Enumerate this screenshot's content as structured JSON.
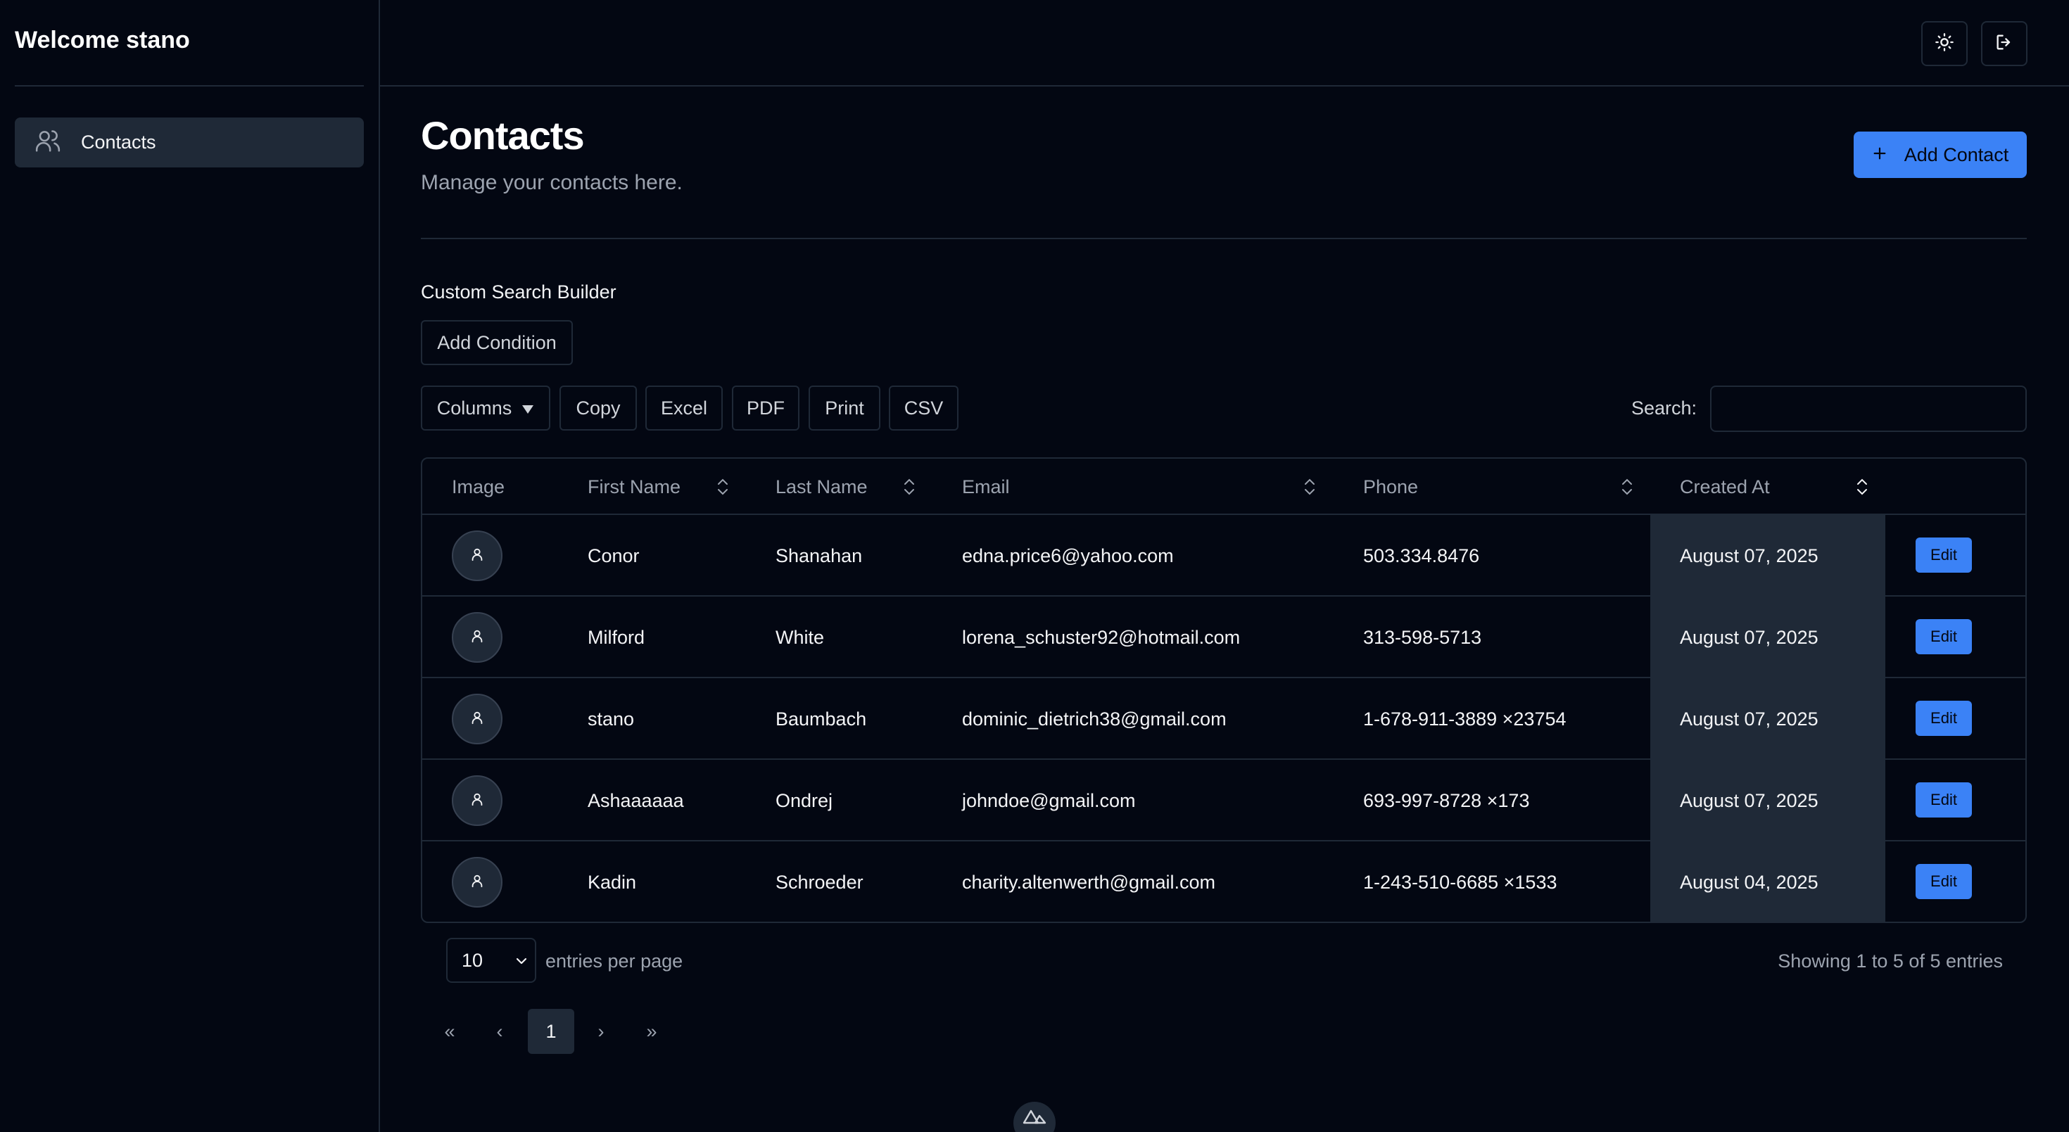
{
  "sidebar": {
    "title": "Welcome stano",
    "items": [
      {
        "label": "Contacts",
        "icon": "users-icon"
      }
    ]
  },
  "topbar": {
    "theme_icon": "sun-icon",
    "logout_icon": "logout-icon"
  },
  "main": {
    "title": "Contacts",
    "subtitle": "Manage your contacts here.",
    "add_button": {
      "label": "Add Contact",
      "icon": "plus-icon"
    },
    "search_builder": {
      "label": "Custom Search Builder",
      "add_condition": "Add Condition"
    },
    "toolbar": {
      "columns": "Columns",
      "copy": "Copy",
      "excel": "Excel",
      "pdf": "PDF",
      "print": "Print",
      "csv": "CSV",
      "search_label": "Search:",
      "search_value": ""
    },
    "table": {
      "headers": [
        "Image",
        "First Name",
        "Last Name",
        "Email",
        "Phone",
        "Created At"
      ],
      "rows": [
        {
          "first": "Conor",
          "last": "Shanahan",
          "email": "edna.price6@yahoo.com",
          "phone": "503.334.8476",
          "created": "August 07, 2025",
          "action": "Edit"
        },
        {
          "first": "Milford",
          "last": "White",
          "email": "lorena_schuster92@hotmail.com",
          "phone": "313-598-5713",
          "created": "August 07, 2025",
          "action": "Edit"
        },
        {
          "first": "stano",
          "last": "Baumbach",
          "email": "dominic_dietrich38@gmail.com",
          "phone": "1-678-911-3889 ×23754",
          "created": "August 07, 2025",
          "action": "Edit"
        },
        {
          "first": "Ashaaaaaa",
          "last": "Ondrej",
          "email": "johndoe@gmail.com",
          "phone": "693-997-8728 ×173",
          "created": "August 07, 2025",
          "action": "Edit"
        },
        {
          "first": "Kadin",
          "last": "Schroeder",
          "email": "charity.altenwerth@gmail.com",
          "phone": "1-243-510-6685 ×1533",
          "created": "August 04, 2025",
          "action": "Edit"
        }
      ]
    },
    "footer": {
      "per_page": "10",
      "per_page_label": "entries per page",
      "showing": "Showing 1 to 5 of 5 entries",
      "pagination": {
        "first": "«",
        "prev": "‹",
        "current": "1",
        "next": "›",
        "last": "»"
      }
    }
  },
  "colors": {
    "background": "#030712",
    "accent": "#3b82f6",
    "surface": "#1f2937",
    "muted_text": "#9ca3af"
  }
}
